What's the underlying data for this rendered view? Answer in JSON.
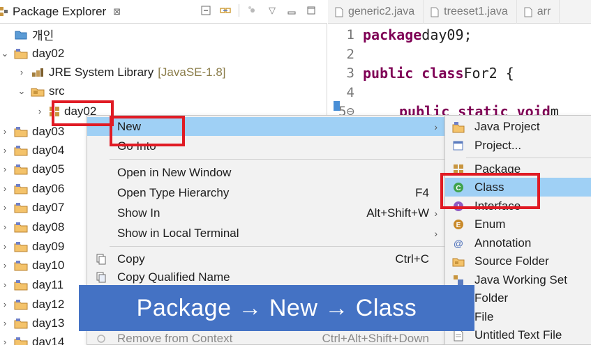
{
  "explorer": {
    "title": "Package Explorer",
    "close_glyph": "⊠",
    "icons": [
      "package-explorer-icon",
      "collapse-all-icon",
      "link-editor-icon",
      "focus-icon",
      "view-menu-icon",
      "minimize-icon",
      "maximize-icon"
    ],
    "tree": [
      {
        "label": "개인",
        "icon": "folder-icon"
      },
      {
        "label": "day02",
        "icon": "project-icon",
        "expanded": true
      },
      {
        "label": "JRE System Library",
        "suffix": "[JavaSE-1.8]",
        "icon": "library-icon"
      },
      {
        "label": "src",
        "icon": "source-folder-icon",
        "expanded": true
      },
      {
        "label": "day02",
        "icon": "package-icon",
        "selected": true
      },
      {
        "label": "day03",
        "icon": "project-icon"
      },
      {
        "label": "day04",
        "icon": "project-icon"
      },
      {
        "label": "day05",
        "icon": "project-icon"
      },
      {
        "label": "day06",
        "icon": "project-icon"
      },
      {
        "label": "day07",
        "icon": "project-icon"
      },
      {
        "label": "day08",
        "icon": "project-icon"
      },
      {
        "label": "day09",
        "icon": "project-icon"
      },
      {
        "label": "day10",
        "icon": "project-icon"
      },
      {
        "label": "day11",
        "icon": "project-icon"
      },
      {
        "label": "day12",
        "icon": "project-icon"
      },
      {
        "label": "day13",
        "icon": "project-icon"
      },
      {
        "label": "day14",
        "icon": "project-icon"
      }
    ]
  },
  "editor": {
    "tabs": [
      "generic2.java",
      "treeset1.java",
      "arr"
    ],
    "lines": [
      {
        "num": "1",
        "kw": "package",
        "text": " day09;"
      },
      {
        "num": "2",
        "kw": "",
        "text": ""
      },
      {
        "num": "3",
        "kw": "public class",
        "text": " For2 {"
      },
      {
        "num": "4",
        "kw": "",
        "text": ""
      },
      {
        "num": "5⊖",
        "kw": "public static void",
        "text": " m"
      }
    ]
  },
  "context_menu": {
    "items": [
      {
        "label": "New",
        "submenu": true,
        "highlighted": true
      },
      {
        "label": "Go Into"
      },
      {
        "label": "Open in New Window"
      },
      {
        "label": "Open Type Hierarchy",
        "shortcut": "F4"
      },
      {
        "label": "Show In",
        "shortcut": "Alt+Shift+W",
        "submenu": true
      },
      {
        "label": "Show in Local Terminal",
        "submenu": true
      },
      {
        "label": "Copy",
        "shortcut": "Ctrl+C",
        "icon": "copy-icon"
      },
      {
        "label": "Copy Qualified Name",
        "icon": "copy-qualified-icon"
      },
      {
        "label": "Remove from Context",
        "shortcut": "Ctrl+Alt+Shift+Down",
        "icon": "remove-context-icon",
        "disabled": true
      }
    ]
  },
  "new_submenu": {
    "items": [
      {
        "label": "Java Project",
        "icon": "java-project-icon"
      },
      {
        "label": "Project...",
        "icon": "project-wizard-icon"
      },
      {
        "label": "Package",
        "icon": "new-package-icon"
      },
      {
        "label": "Class",
        "icon": "new-class-icon",
        "highlighted": true
      },
      {
        "label": "Interface",
        "icon": "new-interface-icon"
      },
      {
        "label": "Enum",
        "icon": "new-enum-icon"
      },
      {
        "label": "Annotation",
        "icon": "new-annotation-icon"
      },
      {
        "label": "Source Folder",
        "icon": "new-source-folder-icon"
      },
      {
        "label": "Java Working Set",
        "icon": "working-set-icon"
      },
      {
        "label": "Folder",
        "icon": "new-folder-icon"
      },
      {
        "label": "File",
        "icon": "new-file-icon"
      },
      {
        "label": "Untitled Text File",
        "icon": "untitled-text-icon"
      }
    ]
  },
  "banner": {
    "text": "Package → New → Class"
  },
  "colors": {
    "highlight": "#9fd0f5",
    "keyword": "#7f0055",
    "redbox": "#e01b24",
    "banner": "#4472c4"
  }
}
